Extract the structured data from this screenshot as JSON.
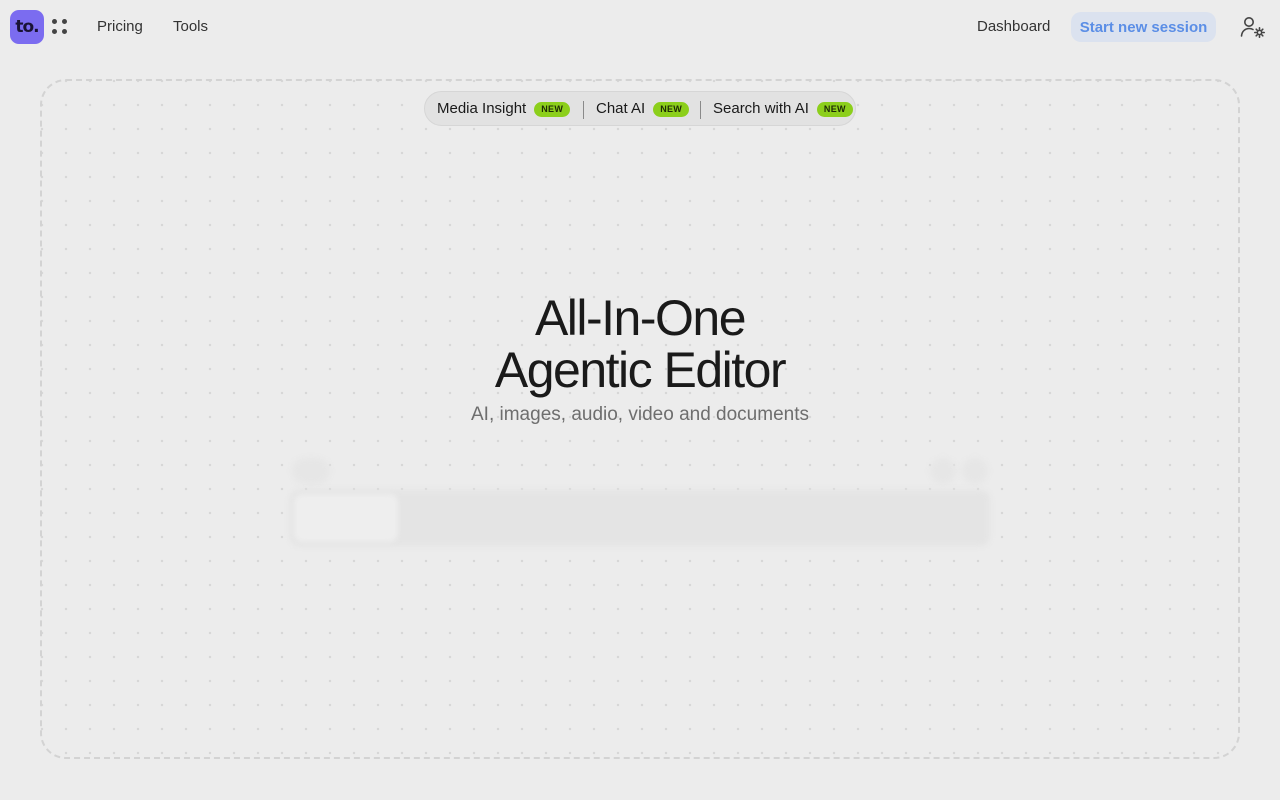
{
  "header": {
    "logo_text": "to.",
    "nav": {
      "pricing": "Pricing",
      "tools": "Tools",
      "dashboard": "Dashboard"
    },
    "start_session_label": "Start new session"
  },
  "features": {
    "items": [
      {
        "label": "Media Insight",
        "badge": "NEW"
      },
      {
        "label": "Chat AI",
        "badge": "NEW"
      },
      {
        "label": "Search with AI",
        "badge": "NEW"
      }
    ]
  },
  "hero": {
    "title_line1": "All-In-One",
    "title_line2": "Agentic Editor",
    "subtitle": "AI, images, audio, video and documents"
  },
  "colors": {
    "logo_bg": "#7b6cf0",
    "accent_text": "#5b8ee6",
    "accent_bg": "#dbe2ef",
    "badge_bg": "#8ccf1b",
    "page_bg": "#ececec"
  },
  "icons": {
    "apps": "grid-dots-icon",
    "user_settings": "user-gear-icon"
  }
}
